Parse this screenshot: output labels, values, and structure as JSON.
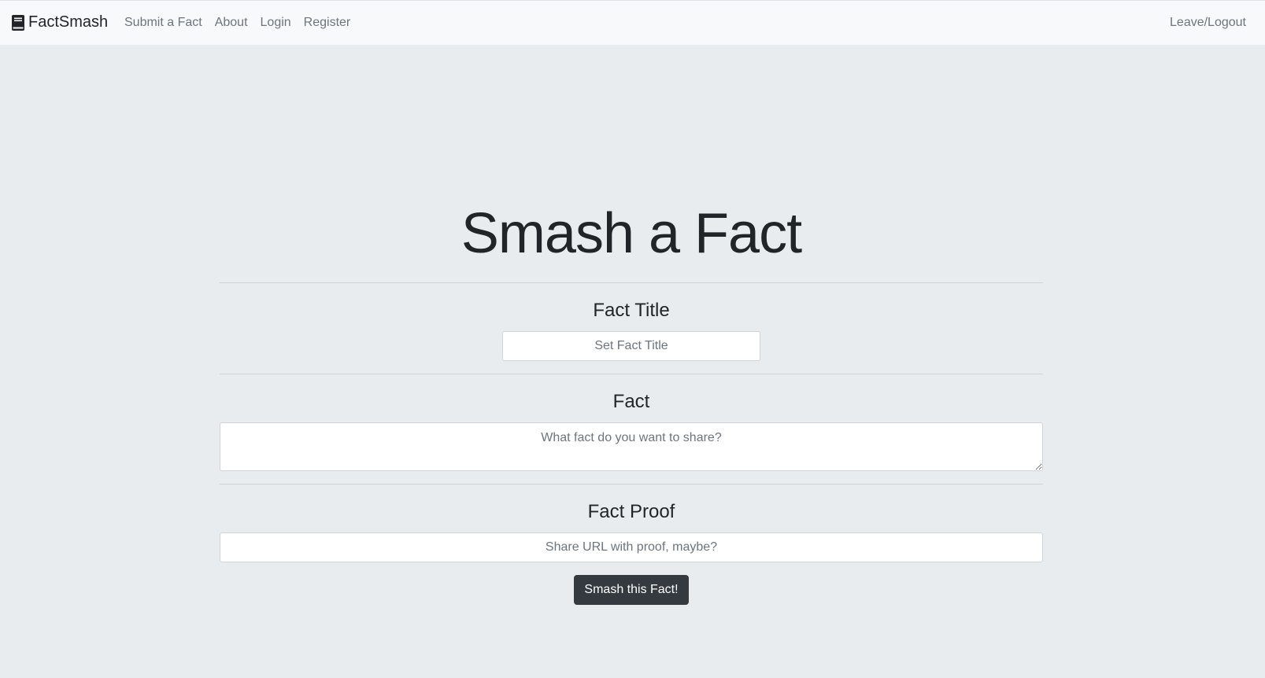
{
  "navbar": {
    "brand": "FactSmash",
    "brand_icon": "book-icon",
    "links": [
      "Submit a Fact",
      "About",
      "Login",
      "Register"
    ],
    "right_link": "Leave/Logout"
  },
  "form": {
    "heading": "Smash a Fact",
    "title_label": "Fact Title",
    "title_placeholder": "Set Fact Title",
    "fact_label": "Fact",
    "fact_placeholder": "What fact do you want to share?",
    "proof_label": "Fact Proof",
    "proof_placeholder": "Share URL with proof, maybe?",
    "submit_label": "Smash this Fact!"
  },
  "colors": {
    "page_background": "#e9ecef",
    "navbar_background": "#f8f9fa",
    "button_background": "#343a40",
    "nav_link": "#6c757d"
  }
}
